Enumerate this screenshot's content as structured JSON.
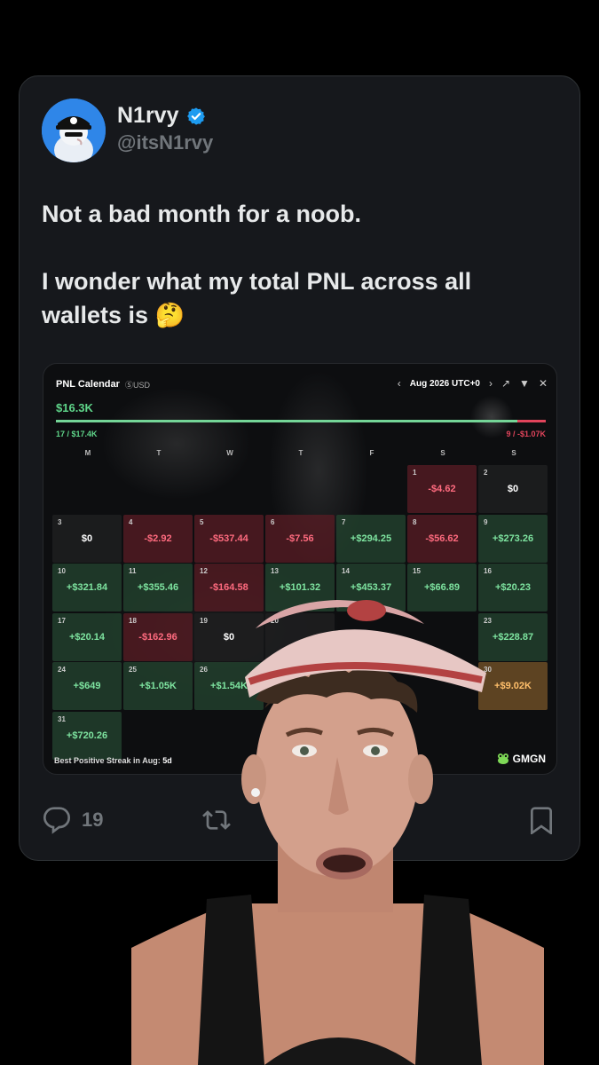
{
  "tweet": {
    "display_name": "N1rvy",
    "handle": "@itsN1rvy",
    "verified": true,
    "text_line1": "Not a bad month for a noob.",
    "text_line2": "I wonder what my total PNL across all wallets is 🤔",
    "actions": {
      "reply_icon": "reply-icon",
      "reply_count": "19",
      "retweet_icon": "retweet-icon",
      "bookmark_icon": "bookmark-icon"
    }
  },
  "pnl_calendar": {
    "title": "PNL Calendar",
    "currency": "ⓈUSD",
    "month_label": "Aug 2026 UTC+0",
    "total": "$16.3K",
    "win_summary": "17 / $17.4K",
    "loss_summary": "9 / -$1.07K",
    "win_fraction": 0.942,
    "weekdays": [
      "M",
      "T",
      "W",
      "T",
      "F",
      "S",
      "S"
    ],
    "days": [
      {
        "day": "1",
        "value": "-$4.62",
        "kind": "neg"
      },
      {
        "day": "2",
        "value": "$0",
        "kind": "zero"
      },
      {
        "day": "3",
        "value": "$0",
        "kind": "zero"
      },
      {
        "day": "4",
        "value": "-$2.92",
        "kind": "neg"
      },
      {
        "day": "5",
        "value": "-$537.44",
        "kind": "neg"
      },
      {
        "day": "6",
        "value": "-$7.56",
        "kind": "neg"
      },
      {
        "day": "7",
        "value": "+$294.25",
        "kind": "pos"
      },
      {
        "day": "8",
        "value": "-$56.62",
        "kind": "neg"
      },
      {
        "day": "9",
        "value": "+$273.26",
        "kind": "pos"
      },
      {
        "day": "10",
        "value": "+$321.84",
        "kind": "pos"
      },
      {
        "day": "11",
        "value": "+$355.46",
        "kind": "pos"
      },
      {
        "day": "12",
        "value": "-$164.58",
        "kind": "neg"
      },
      {
        "day": "13",
        "value": "+$101.32",
        "kind": "pos"
      },
      {
        "day": "14",
        "value": "+$453.37",
        "kind": "pos"
      },
      {
        "day": "15",
        "value": "+$66.89",
        "kind": "pos"
      },
      {
        "day": "16",
        "value": "+$20.23",
        "kind": "pos"
      },
      {
        "day": "17",
        "value": "+$20.14",
        "kind": "pos"
      },
      {
        "day": "18",
        "value": "-$162.96",
        "kind": "neg"
      },
      {
        "day": "19",
        "value": "$0",
        "kind": "zero"
      },
      {
        "day": "20",
        "value": "",
        "kind": "zero"
      },
      {
        "day": "23",
        "value": "+$228.87",
        "kind": "pos"
      },
      {
        "day": "24",
        "value": "+$649",
        "kind": "pos"
      },
      {
        "day": "25",
        "value": "+$1.05K",
        "kind": "pos"
      },
      {
        "day": "26",
        "value": "+$1.54K",
        "kind": "pos"
      },
      {
        "day": "30",
        "value": "+$9.02K",
        "kind": "gold"
      },
      {
        "day": "31",
        "value": "+$720.26",
        "kind": "pos"
      }
    ],
    "streak_label": "Best Positive Streak in Aug:",
    "streak_value": "5d",
    "brand": "GMGN"
  }
}
